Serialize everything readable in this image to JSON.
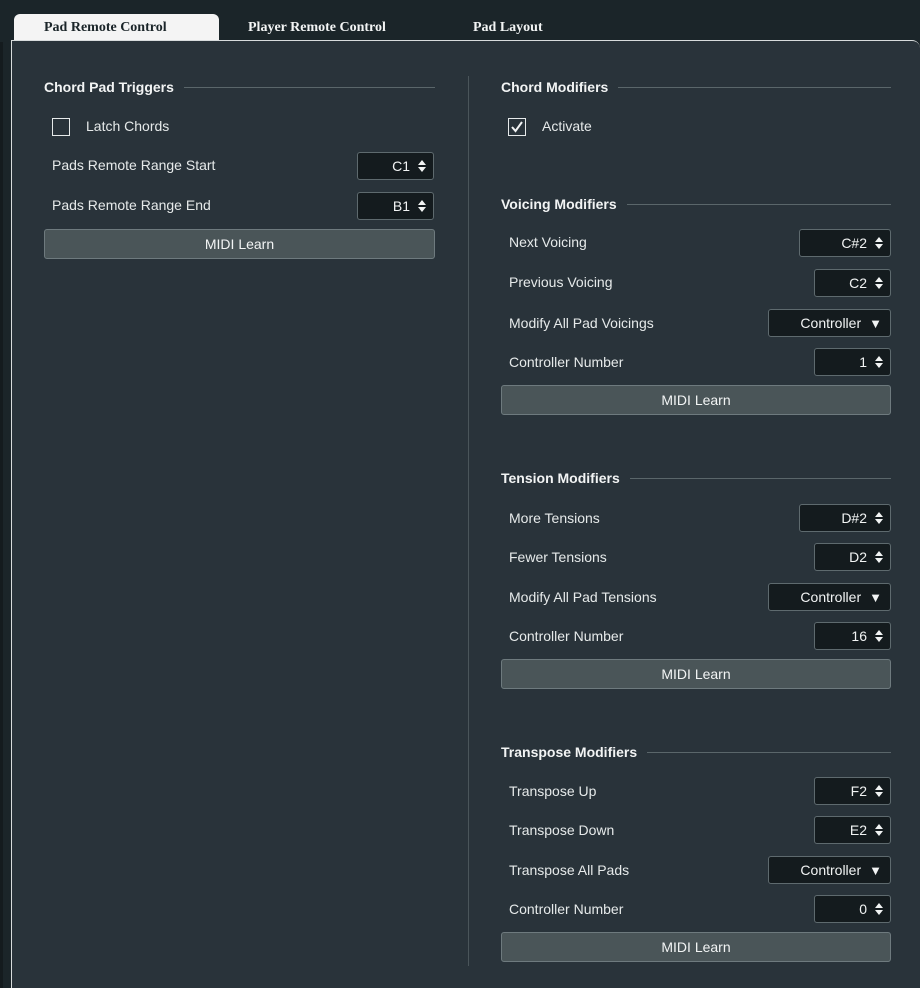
{
  "tabs": [
    {
      "label": "Pad Remote Control",
      "active": true
    },
    {
      "label": "Player Remote Control",
      "active": false
    },
    {
      "label": "Pad Layout",
      "active": false
    }
  ],
  "chord_pad_triggers": {
    "title": "Chord Pad Triggers",
    "latch_label": "Latch Chords",
    "latch_checked": false,
    "range_start_label": "Pads Remote Range Start",
    "range_start_value": "C1",
    "range_end_label": "Pads Remote Range End",
    "range_end_value": "B1",
    "midi_learn": "MIDI Learn"
  },
  "chord_modifiers": {
    "title": "Chord Modifiers",
    "activate_label": "Activate",
    "activate_checked": true
  },
  "voicing_modifiers": {
    "title": "Voicing Modifiers",
    "next_label": "Next Voicing",
    "next_value": "C#2",
    "prev_label": "Previous Voicing",
    "prev_value": "C2",
    "modify_label": "Modify All Pad Voicings",
    "modify_value": "Controller",
    "cc_label": "Controller Number",
    "cc_value": "1",
    "midi_learn": "MIDI Learn"
  },
  "tension_modifiers": {
    "title": "Tension Modifiers",
    "more_label": "More Tensions",
    "more_value": "D#2",
    "fewer_label": "Fewer Tensions",
    "fewer_value": "D2",
    "modify_label": "Modify All Pad Tensions",
    "modify_value": "Controller",
    "cc_label": "Controller Number",
    "cc_value": "16",
    "midi_learn": "MIDI Learn"
  },
  "transpose_modifiers": {
    "title": "Transpose Modifiers",
    "up_label": "Transpose Up",
    "up_value": "F2",
    "down_label": "Transpose Down",
    "down_value": "E2",
    "all_label": "Transpose All Pads",
    "all_value": "Controller",
    "cc_label": "Controller Number",
    "cc_value": "0",
    "midi_learn": "MIDI Learn"
  },
  "icons": {
    "spin": "up-down-arrows-icon",
    "dropdown": "caret-down-icon",
    "checkmark": "checkmark-icon"
  }
}
